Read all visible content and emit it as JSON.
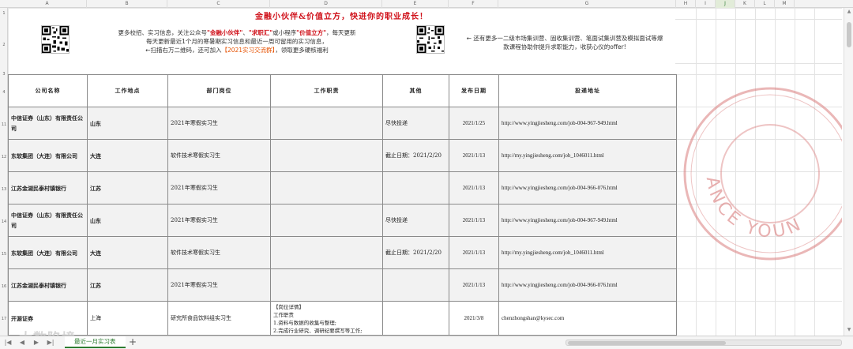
{
  "columns": [
    "A",
    "B",
    "C",
    "D",
    "E",
    "F",
    "G",
    "H",
    "I",
    "J",
    "K",
    "L",
    "M"
  ],
  "selected_column": "J",
  "row_numbers": [
    "1",
    "2",
    "3",
    "4",
    "11",
    "12",
    "13",
    "14",
    "15",
    "16",
    "17"
  ],
  "banner": {
    "title": "金融小伙伴&价值立方，快进你的职业成长！",
    "intro_line1_prefix": "更多校招、实习信息，关注公众号",
    "intro_brand1": "\"金融小伙伴\"",
    "intro_mid": "、",
    "intro_brand2": "\"求职汇\"",
    "intro_mid2": "或小程序",
    "intro_brand3": "\"价值立方\"",
    "intro_line1_suffix": "，每天更新",
    "intro_line2": "每天更新最近1个月的寒暑期实习信息和最近一周可留用的实习信息，",
    "intro_line3_prefix": "←扫描右万二维码，还可加入",
    "intro_group": "【2021实习交流群】",
    "intro_line3_suffix": "，领取更多硬核福利",
    "right_line1": "← 还有更多一二级市场集训营、固收集训营、笔面试集训营及模拟面试等爆",
    "right_line2": "款课程协助你提升求职能力，收获心仪的offer!"
  },
  "table": {
    "headers": [
      "公司名称",
      "工作地点",
      "部门岗位",
      "工作职责",
      "其他",
      "发布日期",
      "投递地址"
    ],
    "rows": [
      {
        "company": "中信证券（山东）有限责任公司",
        "location": "山东",
        "position": "2021年寒假实习生",
        "duty": "",
        "other": "尽快投递",
        "date": "2021/1/25",
        "url": "http://www.yingjiesheng.com/job-004-967-949.html"
      },
      {
        "company": "东软集团（大连）有限公司",
        "location": "大连",
        "position": "软件技术寒假实习生",
        "duty": "",
        "other": "截止日期：2021/2/20",
        "date": "2021/1/13",
        "url": "http://my.yingjiesheng.com/job_1046011.html"
      },
      {
        "company": "江苏金湖民泰村镇银行",
        "location": "江苏",
        "position": "2021年寒假实习生",
        "duty": "",
        "other": "",
        "date": "2021/1/13",
        "url": "http://www.yingjiesheng.com/job-004-966-076.html"
      },
      {
        "company": "中信证券（山东）有限责任公司",
        "location": "山东",
        "position": "2021年寒假实习生",
        "duty": "",
        "other": "尽快投递",
        "date": "2021/1/13",
        "url": "http://www.yingjiesheng.com/job-004-967-949.html"
      },
      {
        "company": "东软集团（大连）有限公司",
        "location": "大连",
        "position": "软件技术寒假实习生",
        "duty": "",
        "other": "截止日期：2021/2/20",
        "date": "2021/1/13",
        "url": "http://my.yingjiesheng.com/job_1046011.html"
      },
      {
        "company": "江苏金湖民泰村镇银行",
        "location": "江苏",
        "position": "2021年寒假实习生",
        "duty": "",
        "other": "",
        "date": "2021/1/13",
        "url": "http://www.yingjiesheng.com/job-004-966-076.html"
      }
    ],
    "last_row": {
      "company": "开源证券",
      "location": "上海",
      "position": "研究所食品饮料组实习生",
      "duty_line1": "【岗位详情】",
      "duty_line2": "工作职责",
      "duty_line3": "1.资料与数据的收集与整理;",
      "duty_line4": "2.完成行业研究、调研纪要撰写等工作;",
      "other": "",
      "date": "2021/3/8",
      "url": "chenzhongshan@kysec.com"
    }
  },
  "stamp_text": "ANCE YOUN",
  "watermark_bottom": "大数陷境",
  "sheet_tab": "最近一月实习表",
  "add_sheet_symbol": "+",
  "nav": {
    "first": "|◀",
    "prev": "◀",
    "next": "▶",
    "last": "▶|"
  },
  "scroll_arrows": {
    "up": "▲",
    "down": "▼"
  },
  "colors": {
    "accent_red": "#d0121b",
    "accent_green": "#2e7d32",
    "row_shade": "#f2f2f2"
  }
}
